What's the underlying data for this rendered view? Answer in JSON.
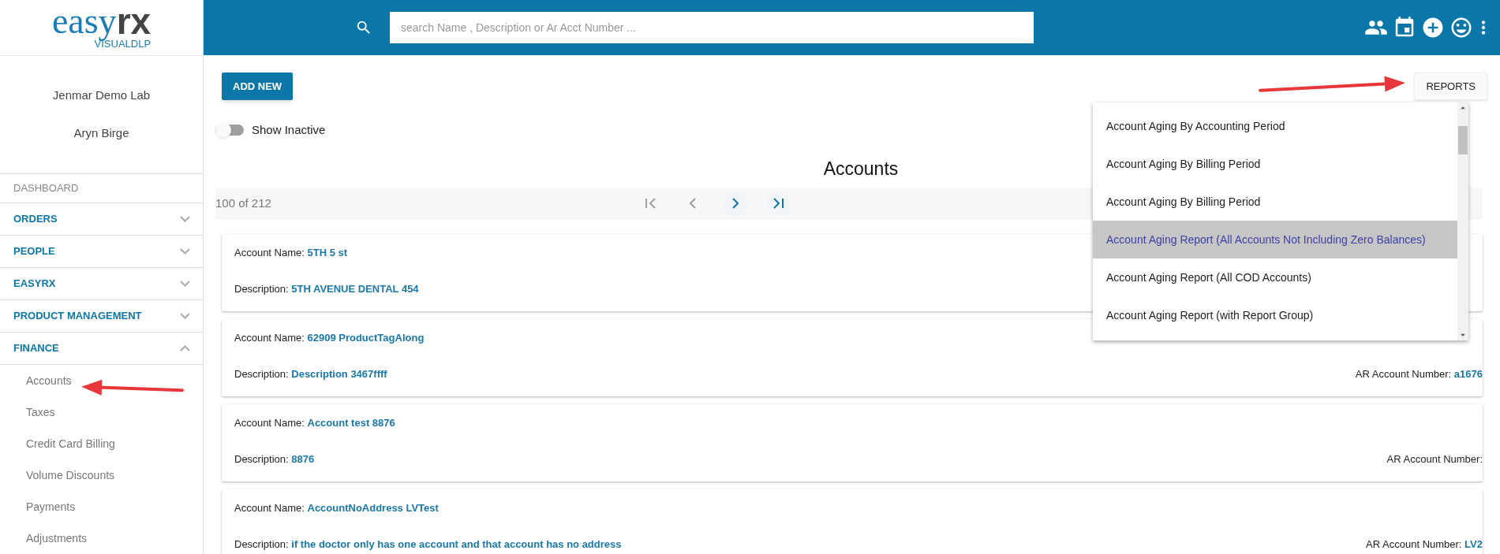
{
  "logo": {
    "wordmark_left": "easy",
    "wordmark_right": "rx",
    "subtitle": "VISUALDLP"
  },
  "search": {
    "placeholder": "search Name , Description or Ar Acct Number ..."
  },
  "user": {
    "lab": "Jenmar Demo Lab",
    "name": "Aryn Birge"
  },
  "sidebar": {
    "dashboard": "DASHBOARD",
    "items": [
      {
        "label": "ORDERS",
        "expanded": false
      },
      {
        "label": "PEOPLE",
        "expanded": false
      },
      {
        "label": "EASYRX",
        "expanded": false
      },
      {
        "label": "PRODUCT MANAGEMENT",
        "expanded": false
      },
      {
        "label": "FINANCE",
        "expanded": true,
        "children": [
          {
            "label": "Accounts"
          },
          {
            "label": "Taxes"
          },
          {
            "label": "Credit Card Billing"
          },
          {
            "label": "Volume Discounts"
          },
          {
            "label": "Payments"
          },
          {
            "label": "Adjustments"
          }
        ]
      }
    ]
  },
  "add_button": "ADD NEW",
  "reports_button": "REPORTS",
  "show_inactive": {
    "label": "Show Inactive",
    "on": false
  },
  "title": "Accounts",
  "pagination": {
    "count": "100 of 212",
    "buttons": [
      {
        "kind": "first",
        "disabled": true
      },
      {
        "kind": "prev",
        "disabled": true
      },
      {
        "kind": "next",
        "disabled": false
      },
      {
        "kind": "last",
        "disabled": false
      }
    ]
  },
  "reports_menu": [
    {
      "label": "Account Aging By Accounting Period",
      "selected": false
    },
    {
      "label": "Account Aging By Billing Period",
      "selected": false
    },
    {
      "label": "Account Aging By Billing Period",
      "selected": false
    },
    {
      "label": "Account Aging Report (All Accounts Not Including Zero Balances)",
      "selected": true
    },
    {
      "label": "Account Aging Report (All COD Accounts)",
      "selected": false
    },
    {
      "label": "Account Aging Report (with Report Group)",
      "selected": false
    }
  ],
  "accounts": [
    {
      "name_label": "Account Name:",
      "name": "5TH 5 st",
      "description_label": "Description:",
      "description": "5TH AVENUE DENTAL 454"
    },
    {
      "name_label": "Account Name:",
      "name": "62909 ProductTagAlong",
      "description_label": "Description:",
      "description": "Description 3467ffff",
      "ar_label": "AR Account Number:",
      "ar_value": "a1676"
    },
    {
      "name_label": "Account Name:",
      "name": "Account test 8876",
      "description_label": "Description:",
      "description": "8876",
      "ar_label": "AR Account Number:"
    },
    {
      "name_label": "Account Name:",
      "name": "AccountNoAddress LVTest",
      "description_label": "Description:",
      "description": "if the doctor only has one account and that account has no address",
      "ar_label": "AR Account Number:",
      "ar_value": "LV2"
    }
  ]
}
